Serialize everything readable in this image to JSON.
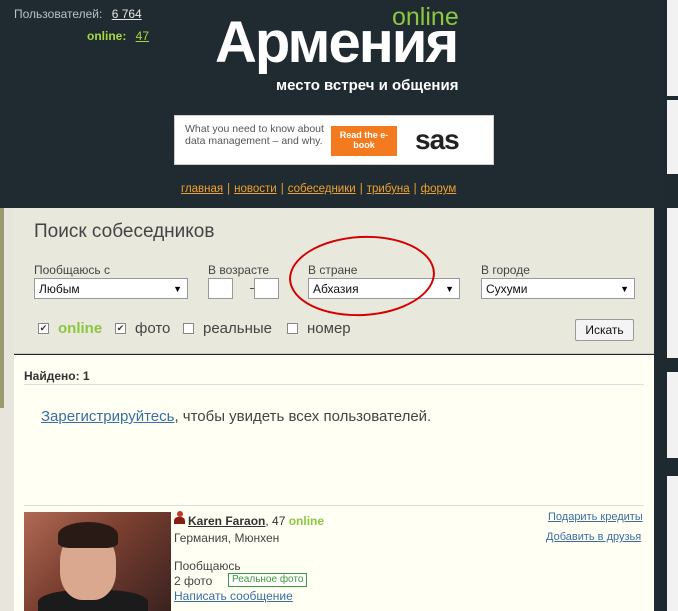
{
  "header": {
    "users_label": "Пользователей:",
    "users_count": "6 764",
    "online_label": "online:",
    "online_count": "47",
    "logo_online": "online",
    "logo_main": "Армения",
    "logo_tagline": "место встреч и общения"
  },
  "ad": {
    "text": "What you need to know about data management – and why.",
    "button": "Read the e-book",
    "brand": "sas"
  },
  "nav": {
    "items": [
      "главная",
      "новости",
      "собеседники",
      "трибуна",
      "форум"
    ]
  },
  "search": {
    "title": "Поиск собеседников",
    "talk_label": "Пообщаюсь с",
    "talk_value": "Любым",
    "age_label": "В возрасте",
    "age_dash": "—",
    "country_label": "В стране",
    "country_value": "Абхазия",
    "city_label": "В городе",
    "city_value": "Сухуми",
    "filters": [
      {
        "label": "online",
        "checked": true
      },
      {
        "label": "фото",
        "checked": true
      },
      {
        "label": "реальные",
        "checked": false
      },
      {
        "label": "номер",
        "checked": false
      }
    ],
    "button": "Искать"
  },
  "results": {
    "found": "Найдено: 1",
    "register_link": "Зарегистрируйтесь",
    "register_rest": ", чтобы увидеть всех пользователей."
  },
  "user": {
    "name": "Karen Faraon",
    "age": ", 47",
    "online": "online",
    "location": "Германия, Мюнхен",
    "looking": "Пообщаюсь",
    "photos": "2 фото",
    "badge": "Реальное фото",
    "message": "Написать сообщение",
    "gift": "Подарить кредиты",
    "add_friend": "Добавить в друзья"
  },
  "colors": {
    "header_bg": "#1f2b31",
    "accent_green": "#8dc63f",
    "nav_orange": "#f0a030",
    "link_blue": "#3a6ea5",
    "panel_bg": "#e9e8dd",
    "annotation_red": "#d40000"
  }
}
